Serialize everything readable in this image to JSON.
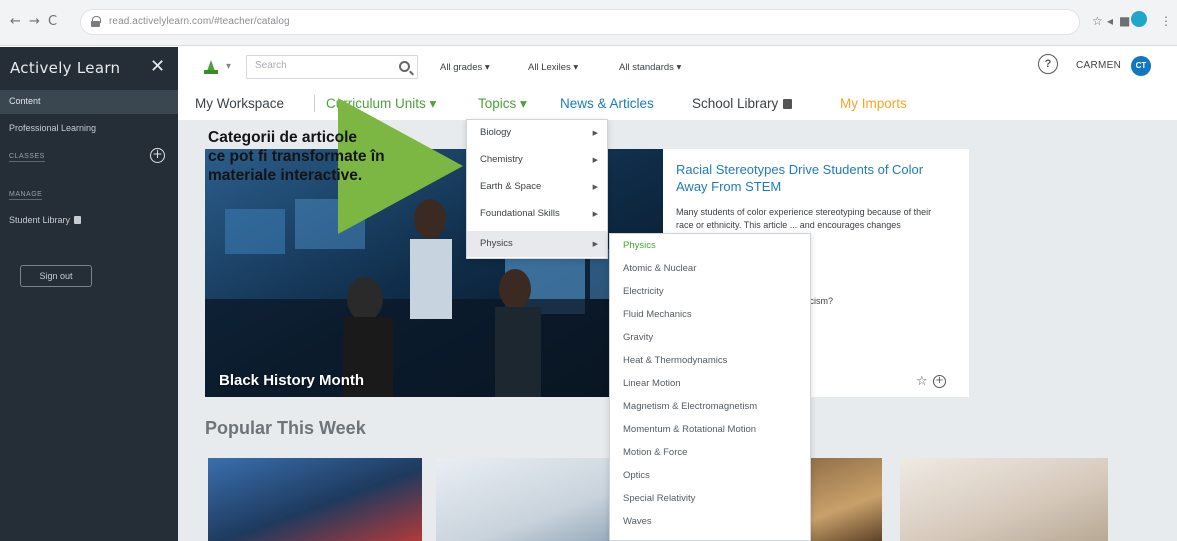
{
  "browser": {
    "url": "read.activelylearn.com/#teacher/catalog"
  },
  "sidebar": {
    "brand": "Actively Learn",
    "close": "✕",
    "active_item": "Content",
    "professional_learning": "Professional Learning",
    "classes_label": "CLASSES",
    "manage_label": "MANAGE",
    "student_library": "Student Library",
    "sign_out": "Sign out"
  },
  "header": {
    "search_placeholder": "Search",
    "filters": [
      "All grades ▾",
      "All Lexiles ▾",
      "All standards ▾"
    ],
    "help": "?",
    "user_name": "CARMEN",
    "user_initials": "CT"
  },
  "nav": {
    "my_workspace": "My Workspace",
    "curriculum_units": "Curriculum Units ▾",
    "topics": "Topics ▾",
    "news_articles": "News & Articles",
    "school_library": "School Library",
    "my_imports": "My Imports"
  },
  "hero": {
    "label": "Black History Month"
  },
  "article": {
    "title": "Racial Stereotypes Drive Students of Color Away From STEM",
    "description": "Many students of color experience stereotyping because of their race or ethnicity. This article ... and encourages changes",
    "question": "... the harm caused by racial ... racism?"
  },
  "popular": {
    "heading": "Popular This Week"
  },
  "annotation": {
    "line1": "Categorii de articole",
    "line2": "ce pot fi transformate în",
    "line3": "materiale interactive."
  },
  "topics_menu": {
    "items": [
      {
        "label": "Biology"
      },
      {
        "label": "Chemistry"
      },
      {
        "label": "Earth & Space"
      },
      {
        "label": "Foundational Skills"
      },
      {
        "label": "Physics"
      }
    ]
  },
  "physics_menu": {
    "items": [
      {
        "label": "Physics"
      },
      {
        "label": "Atomic & Nuclear"
      },
      {
        "label": "Electricity"
      },
      {
        "label": "Fluid Mechanics"
      },
      {
        "label": "Gravity"
      },
      {
        "label": "Heat & Thermodynamics"
      },
      {
        "label": "Linear Motion"
      },
      {
        "label": "Magnetism & Electromagnetism"
      },
      {
        "label": "Momentum & Rotational Motion"
      },
      {
        "label": "Motion & Force"
      },
      {
        "label": "Optics"
      },
      {
        "label": "Special Relativity"
      },
      {
        "label": "Waves"
      }
    ]
  },
  "colors": {
    "sidebar_bg": "#252e36",
    "accent_green": "#4ba23a",
    "link_blue": "#1c7dbd",
    "my_imports": "#f5a623",
    "annotation_arrow": "#7cb744"
  }
}
